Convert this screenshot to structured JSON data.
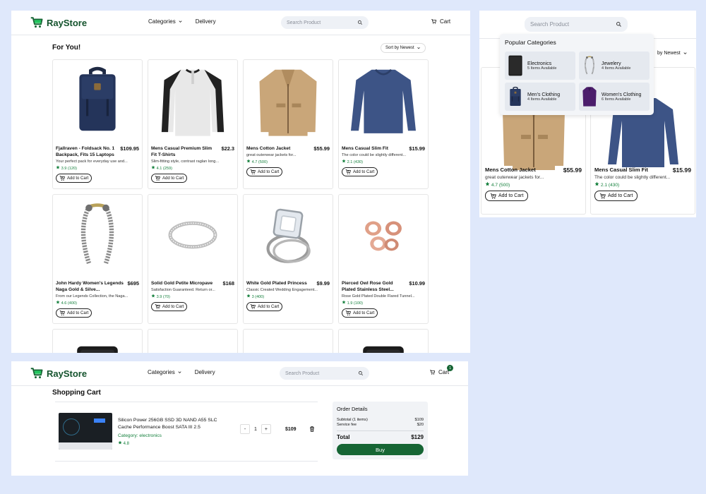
{
  "brand": {
    "name": "RayStore",
    "color": "#166534"
  },
  "nav": {
    "categories": "Categories",
    "delivery": "Delivery"
  },
  "search": {
    "placeholder": "Search Product"
  },
  "cart": {
    "label": "Cart",
    "count": "1"
  },
  "home": {
    "title": "For You!",
    "sort_label": "Sort by Newest",
    "add_label": "Add to Cart",
    "products": [
      {
        "name": "Fjallraven - Foldsack No. 1 Backpack, Fits 15 Laptops",
        "price": "$109.95",
        "desc": "Your perfect pack for everyday use and...",
        "rating": "3.9 (120)",
        "image": "backpack"
      },
      {
        "name": "Mens Casual Premium Slim Fit T-Shirts",
        "price": "$22.3",
        "desc": "Slim-fitting style, contrast raglan long...",
        "rating": "4.1 (259)",
        "image": "raglan-shirt"
      },
      {
        "name": "Mens Cotton Jacket",
        "price": "$55.99",
        "desc": "great outerwear jackets for...",
        "rating": "4.7 (500)",
        "image": "jacket"
      },
      {
        "name": "Mens Casual Slim Fit",
        "price": "$15.99",
        "desc": "The color could be slightly different...",
        "rating": "2.1 (430)",
        "image": "long-sleeve"
      },
      {
        "name": "John Hardy Women's Legends Naga Gold & Silve...",
        "price": "$695",
        "desc": "From our Legends Collection, the Naga...",
        "rating": "4.6 (400)",
        "image": "bracelet"
      },
      {
        "name": "Solid Gold Petite Micropave",
        "price": "$168",
        "desc": "Satisfaction Guaranteed. Return or...",
        "rating": "3.9 (70)",
        "image": "ring"
      },
      {
        "name": "White Gold Plated Princess",
        "price": "$9.99",
        "desc": "Classic Created Wedding Engagement...",
        "rating": "3 (400)",
        "image": "diamond-ring"
      },
      {
        "name": "Pierced Owl Rose Gold Plated Stainless Steel...",
        "price": "$10.99",
        "desc": "Rose Gold Plated Double Flared Tunnel...",
        "rating": "1.9 (100)",
        "image": "plugs"
      }
    ]
  },
  "dropdown": {
    "title": "Popular Categories",
    "sort_label": "by Newest",
    "categories": [
      {
        "name": "Electronics",
        "count": "5 Items Available",
        "image": "hard-drive"
      },
      {
        "name": "Jewelery",
        "count": "4 Items Available",
        "image": "bracelet"
      },
      {
        "name": "Men's Clothing",
        "count": "4 Items Available",
        "image": "backpack"
      },
      {
        "name": "Women's Clothing",
        "count": "6 Items Available",
        "image": "purple-jacket"
      }
    ],
    "cards": [
      {
        "name": "Mens Cotton Jacket",
        "price": "$55.99",
        "desc": "great outerwear jackets for...",
        "rating": "4.7 (500)"
      },
      {
        "name": "Mens Casual Slim Fit",
        "price": "$15.99",
        "desc": "The color could be slightly different...",
        "rating": "2.1 (430)"
      }
    ]
  },
  "shopping_cart": {
    "title": "Shopping Cart",
    "item": {
      "name": "Silicon Power 256GB SSD 3D NAND A55 SLC Cache Performance Boost SATA III 2.5",
      "category": "Category: electronics",
      "rating": "4.8",
      "quantity": "1",
      "price": "$109",
      "decrement": "-",
      "increment": "+"
    },
    "order": {
      "title": "Order Details",
      "subtotal_label": "Subtotal (1 items)",
      "subtotal": "$109",
      "fee_label": "Service fee",
      "fee": "$20",
      "total_label": "Total",
      "total": "$129",
      "buy_label": "Buy"
    }
  }
}
